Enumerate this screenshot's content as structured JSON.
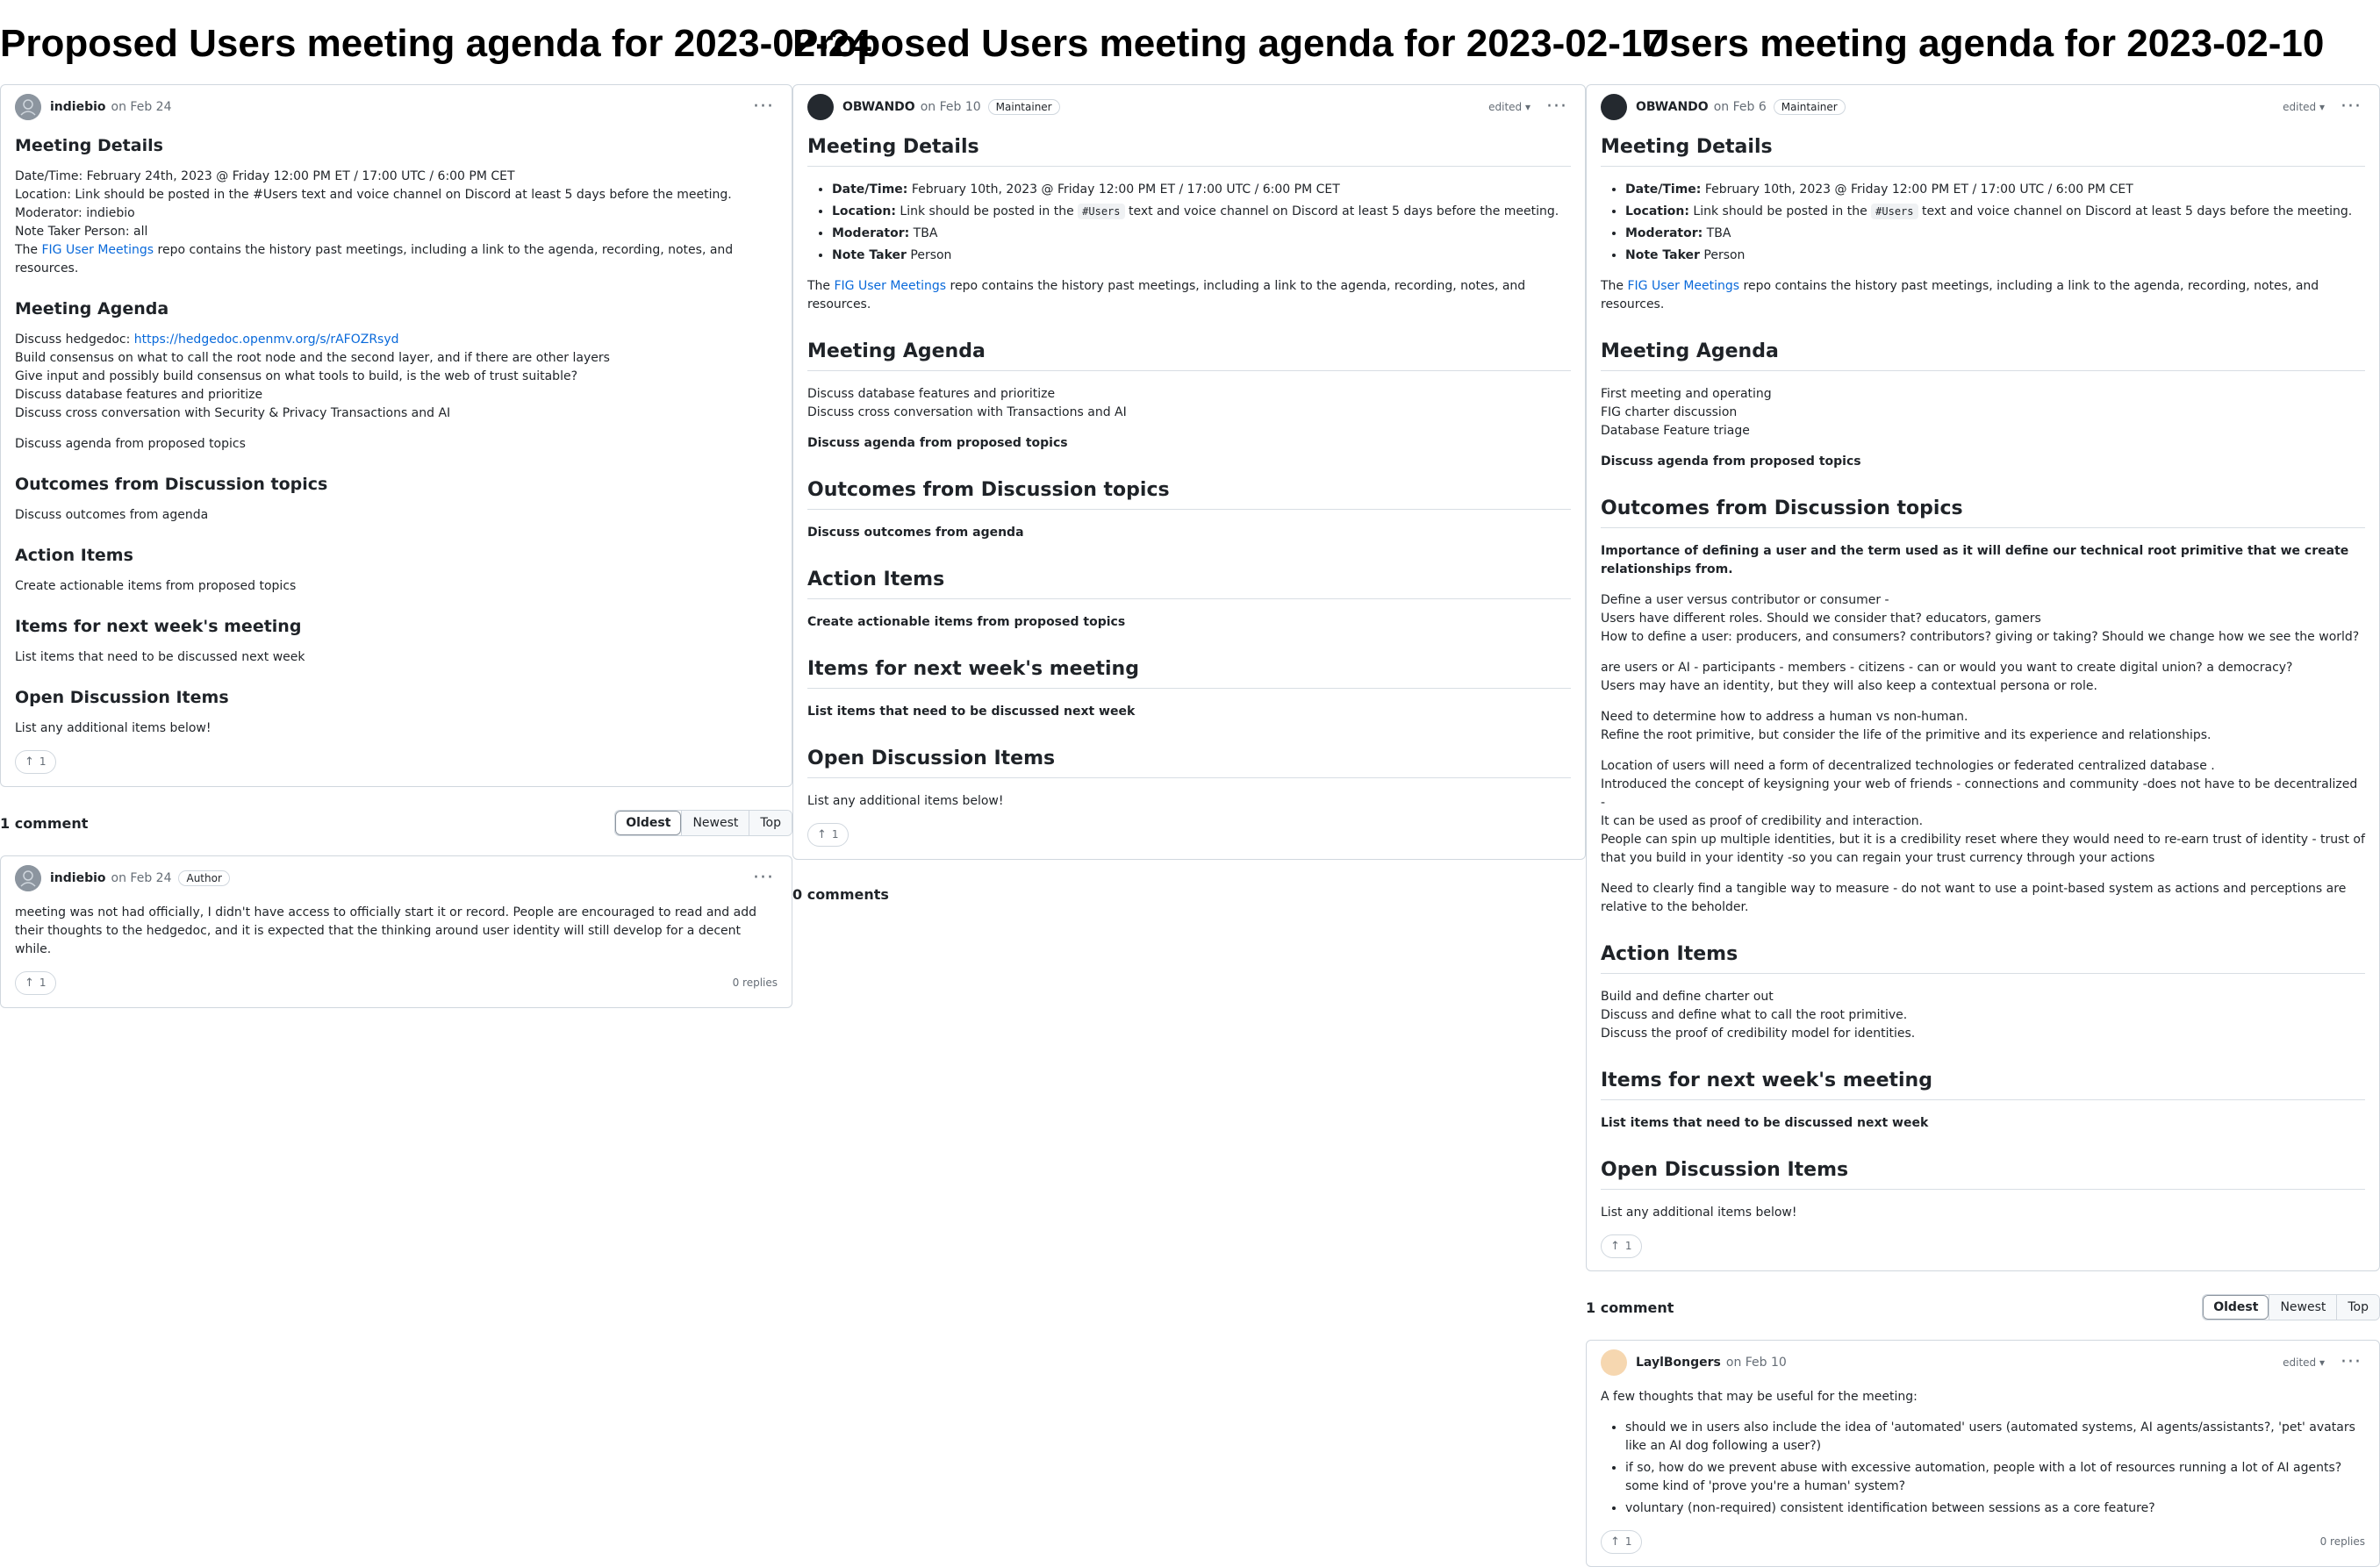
{
  "columns": [
    {
      "title": "Proposed Users meeting agenda for 2023-02-24",
      "post": {
        "author": "indiebio",
        "date": "on Feb 24",
        "h_details": "Meeting Details",
        "details": [
          "Date/Time: February 24th, 2023 @ Friday 12:00 PM ET / 17:00 UTC / 6:00 PM CET",
          "Location: Link should be posted in the #Users text and voice channel on Discord at least 5 days before the meeting.",
          "Moderator: indiebio",
          "Note Taker Person: all"
        ],
        "repo_pre": "The ",
        "repo_link": "FIG User Meetings",
        "repo_post": " repo contains the history past meetings, including a link to the agenda, recording, notes, and resources.",
        "h_agenda": "Meeting Agenda",
        "hedgedoc_label": "Discuss hedgedoc: ",
        "hedgedoc_link": "https://hedgedoc.openmv.org/s/rAFOZRsyd",
        "agenda": [
          "Build consensus on what to call the root node and the second layer, and if there are other layers",
          "Give input and possibly build consensus on what tools to build, is the web of trust suitable?",
          "Discuss database features and prioritize",
          "Discuss cross conversation with Security & Privacy Transactions and AI"
        ],
        "agenda_topics": "Discuss agenda from proposed topics",
        "h_outcomes": "Outcomes from Discussion topics",
        "outcomes": "Discuss outcomes from agenda",
        "h_action": "Action Items",
        "action": "Create actionable items from proposed topics",
        "h_next": "Items for next week's meeting",
        "next": "List items that need to be discussed next week",
        "h_open": "Open Discussion Items",
        "open": "List any additional items below!",
        "upvotes": "1"
      },
      "comments_count": "1 comment",
      "sort": [
        "Oldest",
        "Newest",
        "Top"
      ],
      "comment": {
        "author": "indiebio",
        "date": "on Feb 24",
        "badge": "Author",
        "text": "meeting was not had officially, I didn't have access to officially start it or record. People are encouraged to read and add their thoughts to the hedgedoc, and it is expected that the thinking around user identity will still develop for a decent while.",
        "upvotes": "1",
        "replies": "0 replies"
      }
    },
    {
      "title": "Proposed Users meeting agenda for 2023-02-17",
      "post": {
        "author": "OBWANDO",
        "date": "on Feb 10",
        "badge": "Maintainer",
        "edited": "edited ▾",
        "h_details": "Meeting Details",
        "details": [
          {
            "label": "Date/Time:",
            "text": " February 10th, 2023 @ Friday 12:00 PM ET / 17:00 UTC / 6:00 PM CET"
          },
          {
            "label": "Location:",
            "pre": " Link should be posted in the ",
            "code": "#Users",
            "post": " text and voice channel on Discord at least 5 days before the meeting."
          },
          {
            "label": "Moderator:",
            "text": " TBA"
          },
          {
            "label": "Note Taker",
            "text": " Person"
          }
        ],
        "repo_pre": "The ",
        "repo_link": "FIG User Meetings",
        "repo_post": " repo contains the history past meetings, including a link to the agenda, recording, notes, and resources.",
        "h_agenda": "Meeting Agenda",
        "agenda": [
          "Discuss database features and prioritize",
          "Discuss cross conversation with Transactions and AI"
        ],
        "agenda_topics": "Discuss agenda from proposed topics",
        "h_outcomes": "Outcomes from Discussion topics",
        "outcomes": "Discuss outcomes from agenda",
        "h_action": "Action Items",
        "action": "Create actionable items from proposed topics",
        "h_next": "Items for next week's meeting",
        "next": "List items that need to be discussed next week",
        "h_open": "Open Discussion Items",
        "open": "List any additional items below!",
        "upvotes": "1"
      },
      "comments_count": "0 comments"
    },
    {
      "title": "Users meeting agenda for 2023-02-10",
      "post": {
        "author": "OBWANDO",
        "date": "on Feb 6",
        "badge": "Maintainer",
        "edited": "edited ▾",
        "h_details": "Meeting Details",
        "details": [
          {
            "label": "Date/Time:",
            "text": " February 10th, 2023 @ Friday 12:00 PM ET / 17:00 UTC / 6:00 PM CET"
          },
          {
            "label": "Location:",
            "pre": " Link should be posted in the ",
            "code": "#Users",
            "post": " text and voice channel on Discord at least 5 days before the meeting."
          },
          {
            "label": "Moderator:",
            "text": " TBA"
          },
          {
            "label": "Note Taker",
            "text": " Person"
          }
        ],
        "repo_pre": "The ",
        "repo_link": "FIG User Meetings",
        "repo_post": " repo contains the history past meetings, including a link to the agenda, recording, notes, and resources.",
        "h_agenda": "Meeting Agenda",
        "agenda": [
          "First meeting and operating",
          "FIG charter discussion",
          "Database Feature triage"
        ],
        "agenda_topics": "Discuss agenda from proposed topics",
        "h_outcomes": "Outcomes from Discussion topics",
        "outcomes_bold": "Importance of defining a user and the term used as it will define our technical root primitive that we create relationships from.",
        "outcome_paras": [
          [
            "Define a user versus contributor or consumer -",
            "Users have different roles. Should we consider that? educators, gamers",
            "How to define a user: producers, and consumers? contributors? giving or taking? Should we change how we see the world?"
          ],
          [
            "are users or AI - participants - members - citizens - can or would you want to create digital union? a democracy?",
            "Users may have an identity, but they will also keep a contextual persona or role."
          ],
          [
            "Need to determine how to address a human vs non-human.",
            "Refine the root primitive, but consider the life of the primitive and its experience and relationships."
          ],
          [
            "Location of users will need a form of decentralized technologies or federated centralized database .",
            "Introduced the concept of keysigning your web of friends - connections and community -does not have to be decentralized -",
            "It can be used as proof of credibility and interaction.",
            "People can spin up multiple identities, but it is a credibility reset where they would need to re-earn trust of identity - trust of that you build in your identity -so you can regain your trust currency through your actions"
          ],
          [
            "Need to clearly find a tangible way to measure - do not want to use a point-based system as actions and perceptions are relative to the beholder."
          ]
        ],
        "h_action": "Action Items",
        "action_lines": [
          "Build and define charter out",
          "Discuss and define what to call the root primitive.",
          "Discuss the proof of credibility model for identities."
        ],
        "h_next": "Items for next week's meeting",
        "next": "List items that need to be discussed next week",
        "h_open": "Open Discussion Items",
        "open": "List any additional items below!",
        "upvotes": "1"
      },
      "comments_count": "1 comment",
      "sort": [
        "Oldest",
        "Newest",
        "Top"
      ],
      "comment": {
        "author": "LaylBongers",
        "date": "on Feb 10",
        "edited": "edited ▾",
        "intro": "A few thoughts that may be useful for the meeting:",
        "bullets": [
          "should we in users also include the idea of 'automated' users (automated systems, AI agents/assistants?, 'pet' avatars like an AI dog following a user?)",
          "if so, how do we prevent abuse with excessive automation, people with a lot of resources running a lot of AI agents? some kind of 'prove you're a human' system?",
          "voluntary (non-required) consistent identification between sessions as a core feature?"
        ],
        "upvotes": "1",
        "replies": "0 replies"
      }
    }
  ]
}
